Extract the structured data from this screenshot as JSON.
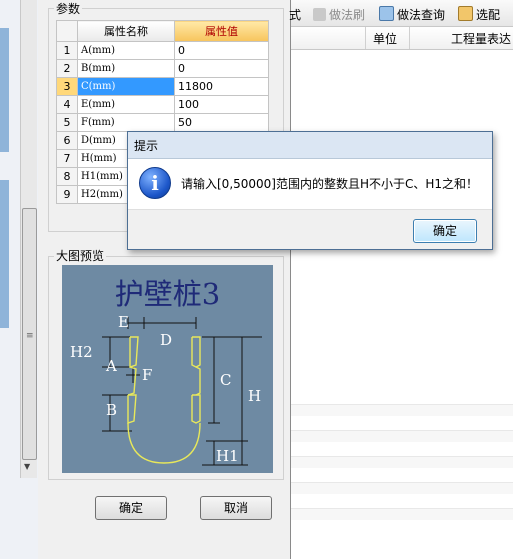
{
  "param_group": {
    "title": "参数",
    "header": {
      "name": "属性名称",
      "value": "属性值"
    },
    "rows": [
      {
        "idx": "1",
        "name": "A(mm)",
        "value": "0"
      },
      {
        "idx": "2",
        "name": "B(mm)",
        "value": "0"
      },
      {
        "idx": "3",
        "name": "C(mm)",
        "value": "11800"
      },
      {
        "idx": "4",
        "name": "E(mm)",
        "value": "100"
      },
      {
        "idx": "5",
        "name": "F(mm)",
        "value": "50"
      },
      {
        "idx": "6",
        "name": "D(mm)",
        "value": ""
      },
      {
        "idx": "7",
        "name": "H(mm)",
        "value": ""
      },
      {
        "idx": "8",
        "name": "H1(mm)",
        "value": ""
      },
      {
        "idx": "9",
        "name": "H2(mm)",
        "value": ""
      }
    ],
    "selected_row": 3
  },
  "preview_group": {
    "title": "大图预览",
    "diagram_title": "护壁桩3",
    "labels": {
      "E": "E",
      "D": "D",
      "H2": "H2",
      "A": "A",
      "F": "F",
      "B": "B",
      "C": "C",
      "H": "H",
      "H1": "H1"
    }
  },
  "buttons": {
    "ok": "确定",
    "cancel": "取消"
  },
  "toolbar": {
    "partial": "式",
    "brush": "做法刷",
    "query": "做法查询",
    "pick": "选配"
  },
  "columns": {
    "partial": "",
    "unit": "单位",
    "expr": "工程量表达式"
  },
  "message_box": {
    "title": "提示",
    "text": "请输入[0,50000]范围内的整数且H不小于C、H1之和！",
    "ok": "确定"
  },
  "colors": {
    "selection": "#3399ff",
    "preview_bg": "#6e8aa3",
    "diagram_title": "#1f2a78",
    "value_header": "#f7c45c"
  }
}
